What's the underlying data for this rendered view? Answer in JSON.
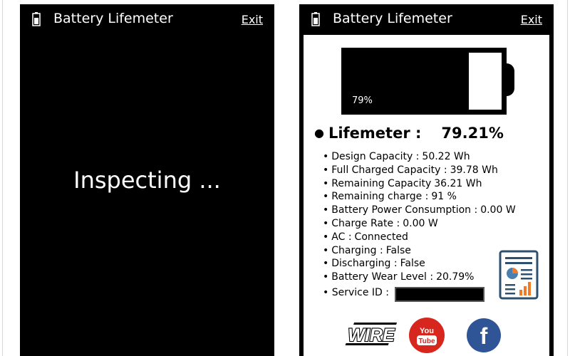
{
  "app": {
    "title": "Battery Lifemeter",
    "exit_label": "Exit"
  },
  "left_window": {
    "status_text": "Inspecting ..."
  },
  "right_window": {
    "battery": {
      "percent_label": "79%",
      "fill_fraction": 0.79
    },
    "lifemeter": {
      "label": "Lifemeter :",
      "value": "79.21%"
    },
    "details": [
      {
        "label": "Design Capacity :",
        "value": "50.22 Wh"
      },
      {
        "label": "Full Charged Capacity :",
        "value": "39.78 Wh"
      },
      {
        "label": "Remaining Capacity",
        "value": "36.21 Wh"
      },
      {
        "label": "Remaining charge :",
        "value": "91 %"
      },
      {
        "label": "Battery Power Consumption :",
        "value": "0.00 W"
      },
      {
        "label": "Charge Rate :",
        "value": "0.00 W"
      },
      {
        "label": "AC :",
        "value": "Connected"
      },
      {
        "label": "Charging :",
        "value": "False"
      },
      {
        "label": "Discharging :",
        "value": "False"
      },
      {
        "label": "Battery Wear Level :",
        "value": "20.79%"
      }
    ],
    "service_id_label": "Service ID :",
    "logos": {
      "wire": "WIRE",
      "youtube_top": "You",
      "youtube_bottom": "Tube",
      "facebook": "f"
    }
  },
  "icons": [
    "battery-icon",
    "report-chart-icon",
    "wire-logo-icon",
    "youtube-icon",
    "facebook-icon"
  ]
}
